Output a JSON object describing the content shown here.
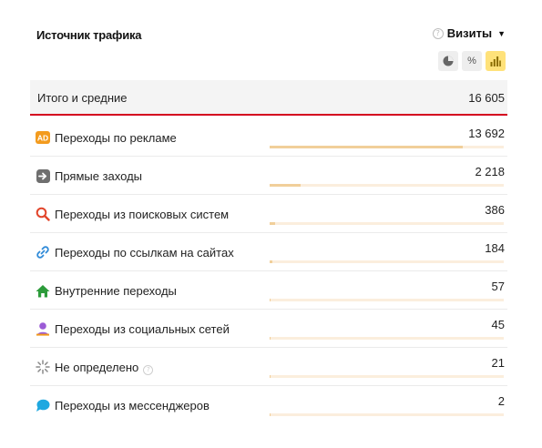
{
  "header": {
    "title": "Источник трафика",
    "metric_label": "Визиты",
    "help_icon": "question-circle-icon",
    "caret_icon": "caret-down-icon"
  },
  "view_toggles": [
    {
      "name": "pie-chart-view",
      "icon": "pie-chart-icon",
      "active": false
    },
    {
      "name": "percent-view",
      "icon": "percent-icon",
      "label": "%",
      "active": false
    },
    {
      "name": "bar-chart-view",
      "icon": "bar-chart-icon",
      "active": true
    }
  ],
  "total": {
    "label": "Итого и средние",
    "value": "16 605"
  },
  "rows": [
    {
      "label": "Переходы по рекламе",
      "value": "13 692",
      "share": 0.825,
      "icon": "ad-icon",
      "badge": "AD"
    },
    {
      "label": "Прямые заходы",
      "value": "2 218",
      "share": 0.1336,
      "icon": "direct-arrow-icon"
    },
    {
      "label": "Переходы из поисковых систем",
      "value": "386",
      "share": 0.0232,
      "icon": "search-magnifier-icon"
    },
    {
      "label": "Переходы по ссылкам на сайтах",
      "value": "184",
      "share": 0.0111,
      "icon": "link-icon"
    },
    {
      "label": "Внутренние переходы",
      "value": "57",
      "share": 0.0034,
      "icon": "home-icon"
    },
    {
      "label": "Переходы из социальных сетей",
      "value": "45",
      "share": 0.0027,
      "icon": "social-user-icon"
    },
    {
      "label": "Не определено",
      "value": "21",
      "share": 0.0013,
      "icon": "undefined-sparkle-icon",
      "has_help": true
    },
    {
      "label": "Переходы из мессенджеров",
      "value": "2",
      "share": 0.0001,
      "icon": "chat-bubble-icon"
    }
  ],
  "colors": {
    "accent_line": "#d4001f",
    "bar_fill": "#f1cf9a",
    "bar_track": "#fbeedd",
    "active_toggle": "#ffe27a"
  }
}
